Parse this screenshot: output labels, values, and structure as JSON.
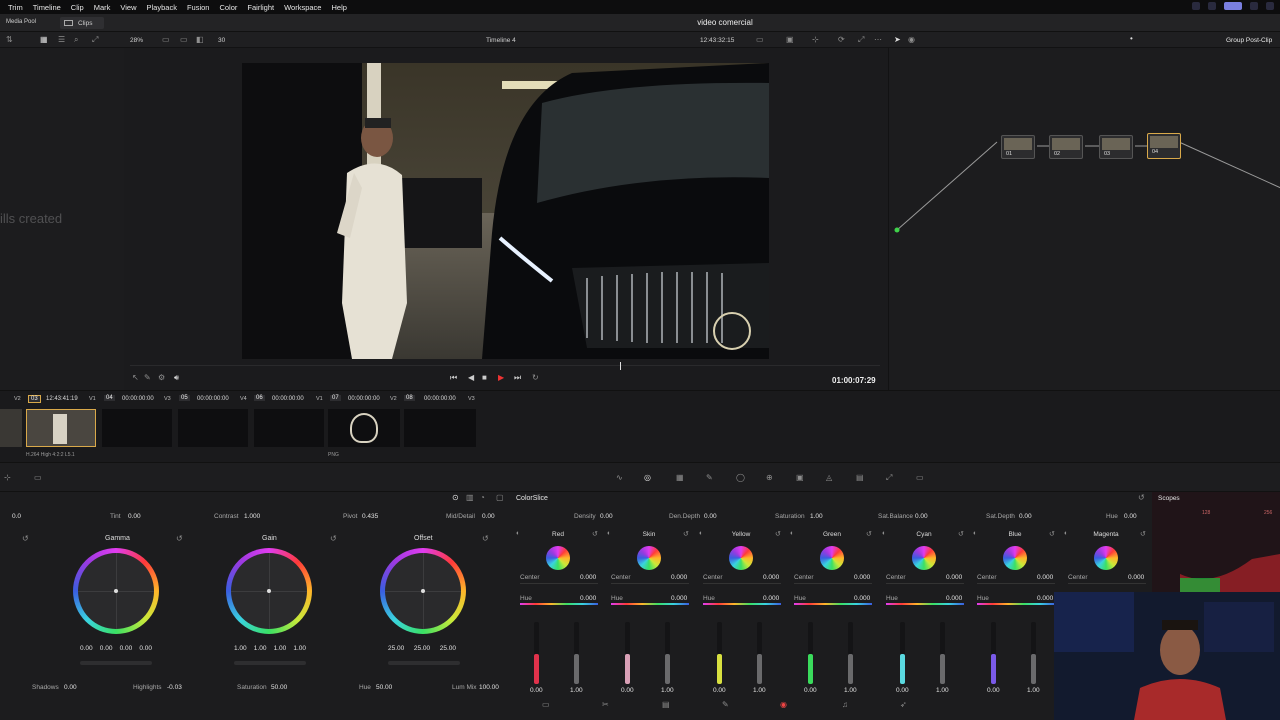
{
  "menu": [
    "Trim",
    "Timeline",
    "Clip",
    "Mark",
    "View",
    "Playback",
    "Fusion",
    "Color",
    "Fairlight",
    "Workspace",
    "Help"
  ],
  "project_title": "video comercial",
  "tabs": {
    "media_pool": "Media Pool",
    "clips": "Clips"
  },
  "toolbar": {
    "zoom": "28%",
    "frame_count": "30",
    "timeline": "Timeline 4",
    "timecode": "12:43:32:15",
    "group": "Group Post-Clip"
  },
  "left_panel": {
    "partial_text": "ills created"
  },
  "transport": {
    "timecode": "01:00:07:29"
  },
  "nodes": [
    "01",
    "02",
    "03",
    "04"
  ],
  "clips": [
    {
      "num": "03",
      "tc": "12:43:41:19",
      "track": "V2",
      "codec": "H.264 High 4:2:2 L5.1"
    },
    {
      "num": "04",
      "tc": "00:00:00:00",
      "track": "V1"
    },
    {
      "num": "05",
      "tc": "00:00:00:00",
      "track": "V3"
    },
    {
      "num": "06",
      "tc": "00:00:00:00",
      "track": "V4"
    },
    {
      "num": "07",
      "tc": "00:00:00:00",
      "track": "V1",
      "codec": "PNG"
    },
    {
      "num": "08",
      "tc": "00:00:00:00",
      "track": "V2"
    },
    {
      "num": "",
      "tc": "",
      "track": "V3"
    }
  ],
  "params_left": {
    "temp": "0.0",
    "tint_label": "Tint",
    "tint": "0.00",
    "contrast_label": "Contrast",
    "contrast": "1.000",
    "pivot_label": "Pivot",
    "pivot": "0.435",
    "mid_label": "Mid/Detail",
    "mid": "0.00"
  },
  "wheels": [
    {
      "name": "Gamma",
      "vals": [
        "0.00",
        "0.00",
        "0.00",
        "0.00"
      ]
    },
    {
      "name": "Gain",
      "vals": [
        "1.00",
        "1.00",
        "1.00",
        "1.00"
      ]
    },
    {
      "name": "Offset",
      "vals": [
        "25.00",
        "25.00",
        "25.00"
      ]
    }
  ],
  "bottom_params": {
    "shadows_label": "Shadows",
    "shadows": "0.00",
    "highlights_label": "Highlights",
    "highlights": "-0.03",
    "saturation_label": "Saturation",
    "saturation": "50.00",
    "hue_label": "Hue",
    "hue": "50.00",
    "lummix_label": "Lum Mix",
    "lummix": "100.00"
  },
  "colorslice": {
    "title": "ColorSlice",
    "density_label": "Density",
    "density": "0.00",
    "dendepth_label": "Den.Depth",
    "dendepth": "0.00",
    "saturation_label": "Saturation",
    "saturation": "1.00",
    "satbal_label": "Sat.Balance",
    "satbal": "0.00",
    "satdepth_label": "Sat.Depth",
    "satdepth": "0.00",
    "hue_label": "Hue",
    "hue": "0.00",
    "center_label": "Center",
    "hue_row_label": "Hue",
    "slices": [
      {
        "name": "Red",
        "center": "0.000",
        "hue": "0.000",
        "a": "0.00",
        "b": "1.00",
        "color": "#e0324b"
      },
      {
        "name": "Skin",
        "center": "0.000",
        "hue": "0.000",
        "a": "0.00",
        "b": "1.00",
        "color": "#d9a0b6"
      },
      {
        "name": "Yellow",
        "center": "0.000",
        "hue": "0.000",
        "a": "0.00",
        "b": "1.00",
        "color": "#d8e040"
      },
      {
        "name": "Green",
        "center": "0.000",
        "hue": "0.000",
        "a": "0.00",
        "b": "1.00",
        "color": "#3adb5c"
      },
      {
        "name": "Cyan",
        "center": "0.000",
        "hue": "0.000",
        "a": "0.00",
        "b": "1.00",
        "color": "#5ad9e0"
      },
      {
        "name": "Blue",
        "center": "0.000",
        "hue": "0.000",
        "a": "0.00",
        "b": "1.00",
        "color": "#7a5ae8"
      },
      {
        "name": "Magenta",
        "center": "0.000",
        "hue": "",
        "a": "",
        "b": "",
        "color": "#d04ad0"
      }
    ]
  },
  "scopes": {
    "title": "Scopes",
    "tick1": "128",
    "tick2": "256"
  }
}
